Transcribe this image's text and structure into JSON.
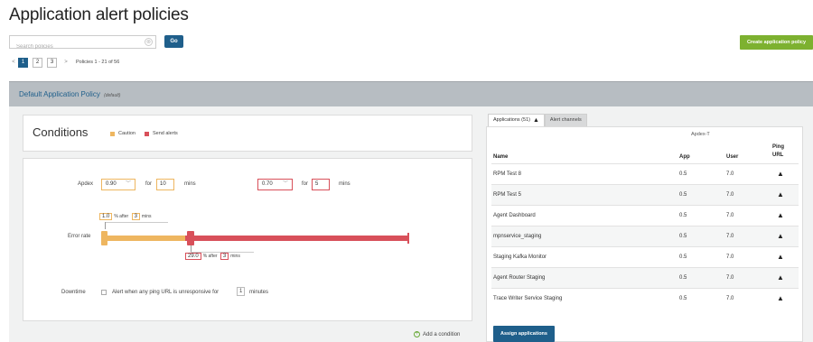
{
  "page": {
    "title": "Application alert policies"
  },
  "search": {
    "placeholder": "Search policies",
    "clear_icon": "⊗",
    "go_label": "Go"
  },
  "create_button": {
    "label": "Create application policy"
  },
  "pagination": {
    "prev": "<",
    "pages": [
      "1",
      "2",
      "3"
    ],
    "active_page": "1",
    "next": ">",
    "info": "Policies 1 - 21 of 56"
  },
  "policy": {
    "name": "Default Application Policy",
    "tag": "(default)"
  },
  "conditions": {
    "title": "Conditions",
    "legend": [
      {
        "label": "Caution",
        "color": "#eeb660"
      },
      {
        "label": "Send alerts",
        "color": "#d8505a"
      }
    ],
    "apdex": {
      "label": "Apdex",
      "caution_value": "0.90",
      "caution_for": "for",
      "caution_minutes": "10",
      "caution_unit": "mins",
      "alert_value": "0.70",
      "alert_for": "for",
      "alert_minutes": "5",
      "alert_unit": "mins"
    },
    "error_rate": {
      "label": "Error rate",
      "caution_value": "1.0",
      "caution_text": "% after",
      "caution_minutes": "3",
      "caution_unit": "mins",
      "alert_value": "29.0",
      "alert_text": "% after",
      "alert_minutes": "3",
      "alert_unit": "mins"
    },
    "downtime": {
      "label": "Downtime",
      "checkbox_text": "Alert when any ping URL is unresponsive for",
      "minutes": "1",
      "unit": "minutes"
    },
    "add_condition": "Add a condition"
  },
  "applications": {
    "tabs": [
      {
        "label": "Applications (51)",
        "warn_icon": "▲"
      },
      {
        "label": "Alert channels"
      }
    ],
    "apdex_header": "Apdex-T",
    "columns": {
      "name": "Name",
      "app": "App",
      "user": "User",
      "ping_line1": "Ping",
      "ping_line2": "URL"
    },
    "rows": [
      {
        "name": "RPM Test 8",
        "app": "0.5",
        "user": "7.0",
        "ping": "▲"
      },
      {
        "name": "RPM Test 5",
        "app": "0.5",
        "user": "7.0",
        "ping": "▲"
      },
      {
        "name": "Agent Dashboard",
        "app": "0.5",
        "user": "7.0",
        "ping": "▲"
      },
      {
        "name": "mpnservice_staging",
        "app": "0.5",
        "user": "7.0",
        "ping": "▲"
      },
      {
        "name": "Staging Kafka Monitor",
        "app": "0.5",
        "user": "7.0",
        "ping": "▲"
      },
      {
        "name": "Agent Router Staging",
        "app": "0.5",
        "user": "7.0",
        "ping": "▲"
      },
      {
        "name": "Trace Writer Service Staging",
        "app": "0.5",
        "user": "7.0",
        "ping": "▲"
      }
    ],
    "assign_button": "Assign applications"
  },
  "colors": {
    "brand_blue": "#1f5f8b",
    "create_green": "#7db130",
    "caution_orange": "#eeb660",
    "alert_red": "#d8505a"
  }
}
